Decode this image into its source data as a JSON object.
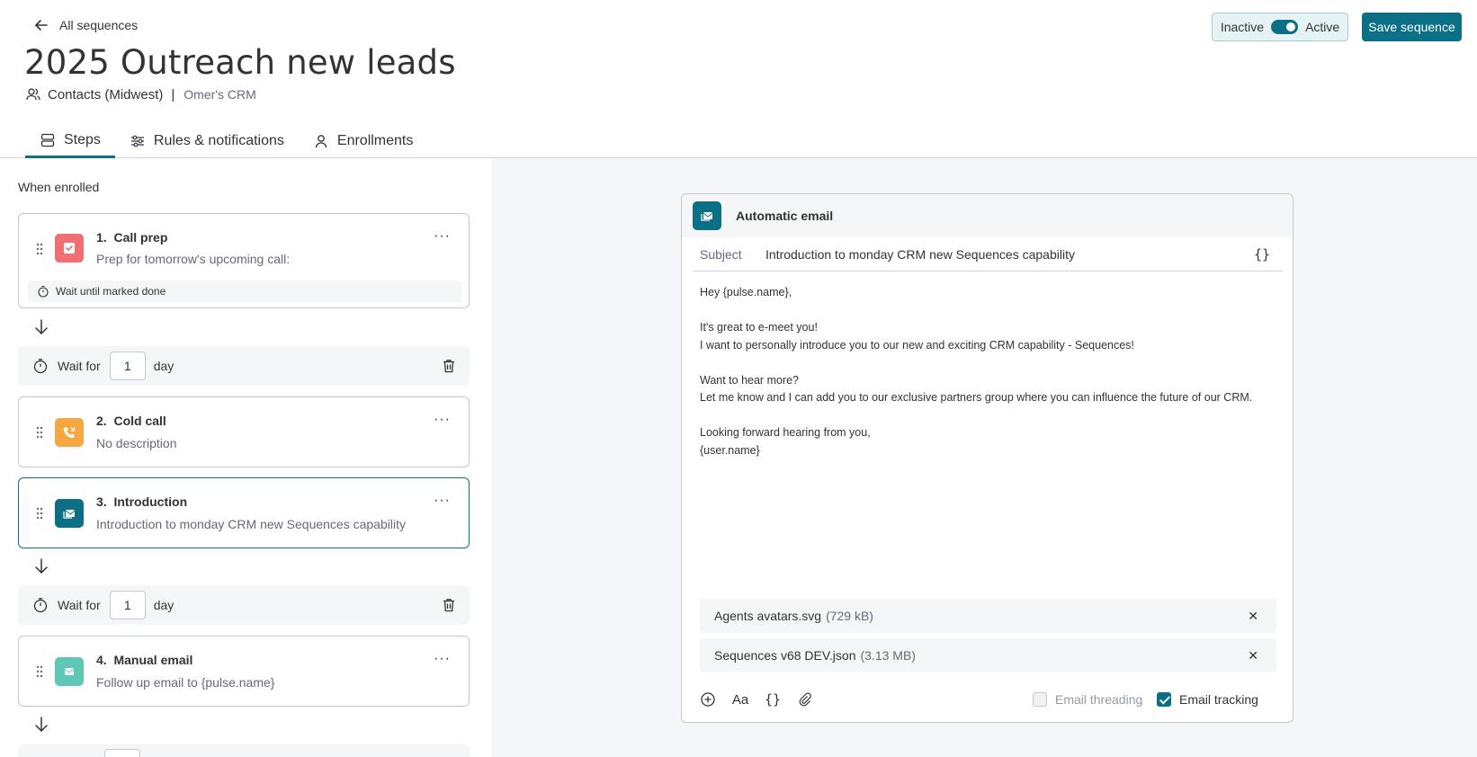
{
  "header": {
    "back_label": "All sequences",
    "title": "2025 Outreach new leads",
    "contacts_label": "Contacts (Midwest)",
    "separator": "|",
    "crm_label": "Omer's CRM",
    "toggle": {
      "inactive_label": "Inactive",
      "active_label": "Active",
      "state": "active"
    },
    "save_label": "Save sequence"
  },
  "tabs": [
    {
      "label": "Steps",
      "icon": "steps-icon",
      "active": true
    },
    {
      "label": "Rules & notifications",
      "icon": "sliders-icon",
      "active": false
    },
    {
      "label": "Enrollments",
      "icon": "person-icon",
      "active": false
    }
  ],
  "steps_panel": {
    "when_enrolled": "When enrolled",
    "steps": [
      {
        "number": "1.",
        "title": "Call prep",
        "description": "Prep for tomorrow's upcoming call:",
        "icon": "checkbox-icon",
        "color": "#f16e73",
        "wait_note": "Wait until marked done"
      },
      {
        "number": "2.",
        "title": "Cold call",
        "description": "No description",
        "icon": "phone-icon",
        "color": "#f5a742"
      },
      {
        "number": "3.",
        "title": "Introduction",
        "description": "Introduction to monday CRM new Sequences capability",
        "icon": "auto-email-icon",
        "color": "#0b6f86",
        "selected": true
      },
      {
        "number": "4.",
        "title": "Manual email",
        "description": "Follow up email to {pulse.name}",
        "icon": "email-icon",
        "color": "#5fc8b5"
      }
    ],
    "waits": [
      {
        "prefix": "Wait for",
        "value": "1",
        "unit": "day"
      },
      {
        "prefix": "Wait for",
        "value": "1",
        "unit": "day"
      }
    ]
  },
  "editor": {
    "title": "Automatic email",
    "subject_label": "Subject",
    "subject_value": "Introduction to monday CRM new Sequences capability",
    "variables_label": "{}",
    "body_lines": [
      "Hey {pulse.name},",
      "",
      "It's great to e-meet you!",
      "I want to personally introduce you to our new and exciting CRM capability - Sequences!",
      "",
      "Want to hear more?",
      "Let me know and I can add you to our exclusive partners group where you can influence the future of our CRM.",
      "",
      "Looking forward hearing from you,",
      "{user.name}"
    ],
    "attachments": [
      {
        "name": "Agents avatars.svg",
        "size": "(729 kB)"
      },
      {
        "name": "Sequences v68 DEV.json",
        "size": "(3.13 MB)"
      }
    ],
    "toolbar": {
      "font_label": "Aa",
      "vars_label": "{}"
    },
    "email_threading": {
      "label": "Email threading",
      "checked": false
    },
    "email_tracking": {
      "label": "Email tracking",
      "checked": true
    }
  }
}
